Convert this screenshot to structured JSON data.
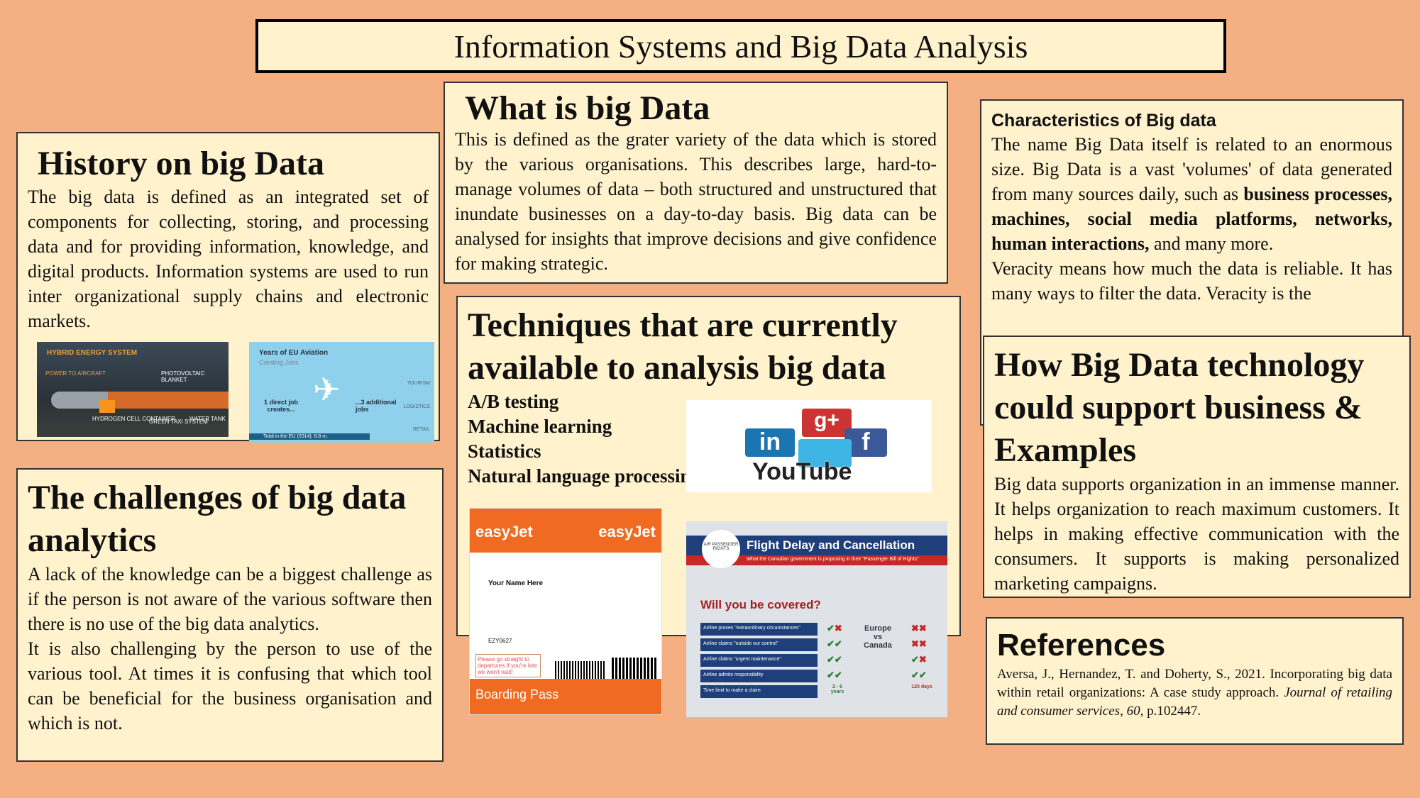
{
  "title": "Information Systems and Big Data Analysis",
  "history": {
    "heading": "History on big Data",
    "text": "The big data is defined as an integrated set of components for collecting, storing, and processing data and for providing information, knowledge, and digital products. Information systems are used to run inter organizational supply chains and electronic markets."
  },
  "what": {
    "heading": "What is big Data",
    "text": "This is defined as the grater variety of the data which is stored by the various organisations. This  describes large, hard-to-manage volumes of data – both structured and unstructured  that inundate businesses on a day-to-day basis. Big data can be analysed for insights that improve decisions and give confidence for making strategic."
  },
  "characteristics": {
    "heading": "Characteristics of Big data",
    "text1": "The name Big Data itself is related to an enormous size. Big Data is a vast 'volumes' of data generated from many sources daily, such as ",
    "bold": "business processes, machines, social media platforms, networks, human interactions,",
    "text2": " and many more.",
    "text3": "Veracity means how much the data is reliable. It has many ways to filter  the data. Veracity is the"
  },
  "techniques": {
    "heading": "Techniques that are currently available to analysis big data",
    "items": [
      "A/B testing",
      "Machine learning",
      "Statistics",
      "Natural language processing"
    ]
  },
  "challenges": {
    "heading": "The challenges of big data analytics",
    "p1": "A lack of the knowledge can be a biggest challenge as if the person is not aware of the various software then there is no use of the big data analytics.",
    "p2": "It is also challenging by the person to use of the various tool. At times it is confusing that which tool can be beneficial for the business organisation and which is not."
  },
  "how": {
    "heading": "How Big Data technology could support business & Examples",
    "text": "Big data supports organization in an immense manner. It helps organization to reach maximum customers. It helps in making effective communication with the consumers. It supports is making personalized marketing campaigns."
  },
  "references": {
    "heading": "References",
    "text": "Aversa, J., Hernandez, T. and Doherty, S., 2021. Incorporating big data within retail organizations: A case study approach. ",
    "journal": "Journal of retailing and consumer services",
    "text2": ", ",
    "vol": "60",
    "text3": ", p.102447."
  },
  "images": {
    "hybrid": {
      "title": "HYBRID ENERGY SYSTEM",
      "labels": [
        "POWER TO AIRCRAFT",
        "PHOTOVOLTAIC BLANKET",
        "HYDROGEN CELL CONTAINER",
        "GREEN TAXI SYSTEM",
        "WATER TANK"
      ]
    },
    "eu": {
      "title": "Years of EU Aviation",
      "subtitle": "Creating Jobs",
      "left": "1 direct job creates...",
      "right": "...3 additional jobs",
      "footer": "Total in the EU (2014): 8.8 m.",
      "cats": [
        "TOURISM",
        "LOGISTICS",
        "RETAIL"
      ]
    },
    "social": {
      "logos": [
        "in",
        "g+",
        "f",
        "YouTube"
      ]
    },
    "pass": {
      "brand": "easyJet",
      "name": "Your Name Here",
      "flight": "EZY0627",
      "notice": "Please go straight to departures If you're late we won't wait!",
      "footer": "Boarding Pass"
    },
    "flight": {
      "title": "Flight Delay and Cancellation",
      "subtitle": "What the Canadian government is proposing in their \"Passenger Bill of Rights\"",
      "badge": "AIR PASSENGER RIGHTS",
      "question": "Will you be covered?",
      "rows": [
        "Airline proves \"extraordinary circumstances\"",
        "Airline claims \"outside our control\"",
        "Airline claims \"urgent maintenance\"",
        "Airline admits responsibility",
        "Time limit to make a claim"
      ],
      "vs": "Europe vs Canada",
      "eu_limit": "2 - 6 years",
      "ca_limit": "120 days"
    }
  }
}
